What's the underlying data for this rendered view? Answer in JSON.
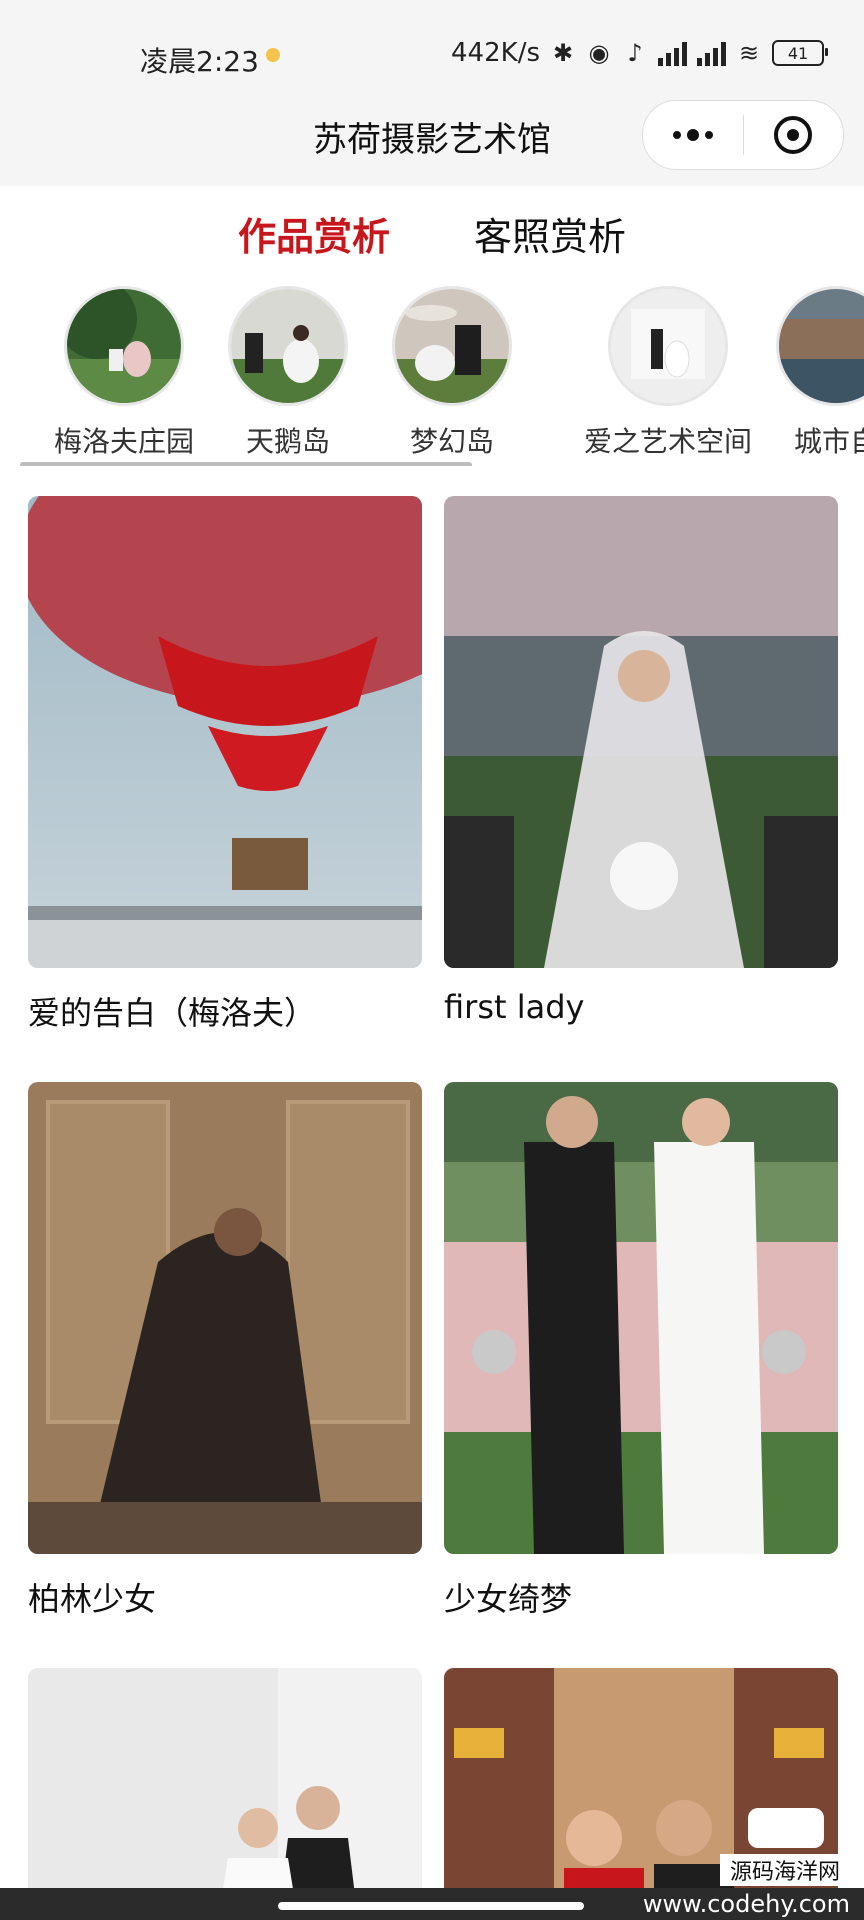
{
  "status_bar": {
    "time": "凌晨2:23",
    "net_speed": "442K/s",
    "battery": "41",
    "icons": [
      "bluetooth-icon",
      "vibrate-icon",
      "mute-icon",
      "signal-icon",
      "signal-icon",
      "wifi-icon",
      "battery-icon"
    ]
  },
  "app": {
    "title": "苏荷摄影艺术馆"
  },
  "tabs": [
    {
      "label": "作品赏析",
      "active": true
    },
    {
      "label": "客照赏析",
      "active": false
    }
  ],
  "categories": [
    {
      "label": "梅洛夫庄园"
    },
    {
      "label": "天鹅岛"
    },
    {
      "label": "梦幻岛"
    },
    {
      "label": "爱之艺术空间"
    },
    {
      "label": "城市自"
    }
  ],
  "gallery": [
    {
      "caption": "爱的告白（梅洛夫）"
    },
    {
      "caption": "first lady"
    },
    {
      "caption": "柏林少女"
    },
    {
      "caption": "少女绮梦"
    },
    {
      "caption": ""
    },
    {
      "caption": ""
    }
  ],
  "watermark": {
    "line1": "源码海洋网",
    "line2": "www.codehy.com"
  },
  "colors": {
    "accent": "#c8161d",
    "background": "#ffffff",
    "topbar": "#f5f5f5"
  }
}
